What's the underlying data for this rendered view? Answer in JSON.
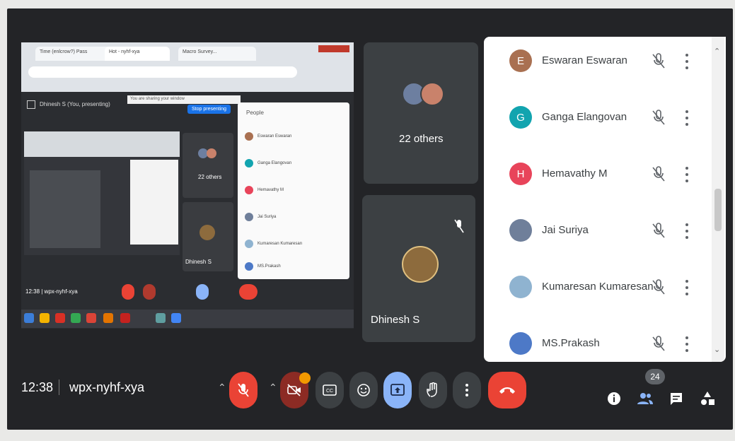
{
  "meeting": {
    "time": "12:38",
    "code": "wpx-nyhf-xya",
    "participant_count": "24"
  },
  "shared_screen": {
    "tabs": [
      "Time (enlcrow?) Pass",
      "Hot - nyhf-xya",
      "Macro Survey..."
    ],
    "presenting_label": "Dhinesh S (You, presenting)",
    "stop_presenting": "Stop presenting",
    "sharing_notice": "You are sharing your window",
    "mini_people_title": "People",
    "mini_people": [
      "Eswaran Eswaran",
      "Ganga Elangovan",
      "Hemavathy M",
      "Jai Suriya",
      "Kumaresan Kumaresan",
      "MS.Prakash"
    ],
    "mini_others": "22 others",
    "mini_presenter": "Dhinesh S",
    "mini_meeting": "12:38 | wpx-nyhf-xya"
  },
  "tiles": {
    "others_label": "22 others",
    "presenter_name": "Dhinesh S"
  },
  "people": [
    {
      "initial": "E",
      "name": "Eswaran Eswaran",
      "color": "#a97051"
    },
    {
      "initial": "G",
      "name": "Ganga Elangovan",
      "color": "#12a4af"
    },
    {
      "initial": "H",
      "name": "Hemavathy M",
      "color": "#e8445a"
    },
    {
      "initial": "",
      "name": "Jai Suriya",
      "color": "#6f7f9a"
    },
    {
      "initial": "",
      "name": "Kumaresan Kumaresan",
      "color": "#8fb3d0"
    },
    {
      "initial": "",
      "name": "MS.Prakash",
      "color": "#4d79c7"
    }
  ],
  "colors": {
    "end_call": "#ea4335",
    "mic_off": "#ea4335",
    "present_active": "#8ab4f8",
    "control_bg": "#3c4043"
  },
  "controls": [
    "mic-off-icon",
    "camera-off-icon",
    "captions-icon",
    "emoji-icon",
    "present-icon",
    "raise-hand-icon",
    "more-options-icon",
    "end-call-icon"
  ],
  "right_controls": [
    "info-icon",
    "people-icon",
    "chat-icon",
    "activities-icon"
  ]
}
